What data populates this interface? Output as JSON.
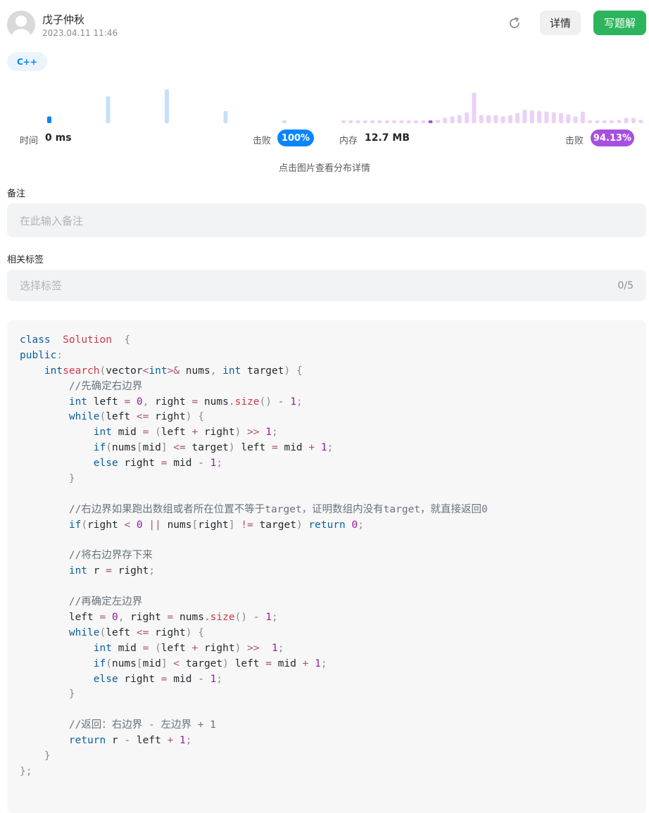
{
  "header": {
    "username": "戊子仲秋",
    "timestamp": "2023.04.11 11:46",
    "refresh_icon": "refresh-icon",
    "detail_label": "详情",
    "write_label": "写题解"
  },
  "language_tag": "C++",
  "stats": {
    "time": {
      "label": "时间",
      "value": "0 ms",
      "beat_label": "击败",
      "beat_value": "100%"
    },
    "memory": {
      "label": "内存",
      "value": "12.7 MB",
      "beat_label": "击败",
      "beat_value": "94.13%"
    },
    "hint": "点击图片查看分布详情"
  },
  "colors": {
    "time_accent": "#0a84ff",
    "time_bar": "#c4e0fb",
    "memory_accent": "#a64fe0",
    "memory_bar": "#ead1f6",
    "primary_button": "#2db55d"
  },
  "chart_data": [
    {
      "type": "bar",
      "name": "runtime-distribution",
      "values": [
        1,
        0,
        0,
        0,
        0,
        0,
        0,
        0,
        0,
        0,
        4,
        0,
        0,
        0,
        0,
        0,
        0,
        0,
        0,
        0,
        5,
        0,
        0,
        0,
        0,
        0,
        0,
        0,
        0,
        0,
        1.8,
        0,
        0,
        0,
        0,
        0,
        0,
        0,
        0,
        0,
        0.4
      ],
      "highlight_index": 0
    },
    {
      "type": "bar",
      "name": "memory-distribution",
      "values": [
        0.2,
        0.2,
        0.2,
        0.2,
        0.2,
        0.2,
        0.2,
        0.2,
        0.2,
        0.2,
        0.2,
        0.2,
        0.3,
        0.5,
        0.8,
        1.0,
        1.2,
        1.6,
        4.5,
        1.2,
        1.2,
        1.2,
        1.0,
        1.2,
        1.5,
        2.0,
        1.9,
        1.8,
        1.7,
        1.6,
        1.5,
        1.3,
        1.0,
        1.7,
        0.4,
        0.2,
        0.2,
        0.2,
        0.5,
        0.8,
        0.8,
        0.5
      ],
      "highlight_index": 12
    }
  ],
  "remark": {
    "label": "备注",
    "placeholder": "在此输入备注"
  },
  "tags": {
    "label": "相关标签",
    "placeholder": "选择标签",
    "count": "0/5"
  },
  "code_lines": [
    [
      [
        "kw",
        "class"
      ],
      [
        "",
        "  "
      ],
      [
        "cls",
        "Solution"
      ],
      [
        "",
        "  "
      ],
      [
        "pn",
        "{"
      ]
    ],
    [
      [
        "kw",
        "public"
      ],
      [
        "pn",
        ":"
      ]
    ],
    [
      [
        "",
        "    "
      ],
      [
        "ty",
        "int"
      ],
      [
        "",
        ""
      ],
      [
        "fn",
        "search"
      ],
      [
        "pn",
        "("
      ],
      [
        "",
        "vector"
      ],
      [
        "op",
        "<"
      ],
      [
        "ty",
        "int"
      ],
      [
        "op",
        ">&"
      ],
      [
        "",
        " nums"
      ],
      [
        "pn",
        ","
      ],
      [
        "",
        " "
      ],
      [
        "ty",
        "int"
      ],
      [
        "",
        " target"
      ],
      [
        "pn",
        ")"
      ],
      [
        "",
        " "
      ],
      [
        "pn",
        "{"
      ]
    ],
    [
      [
        "",
        "        "
      ],
      [
        "cm",
        "//先确定右边界"
      ]
    ],
    [
      [
        "",
        "        "
      ],
      [
        "ty",
        "int"
      ],
      [
        "",
        " left "
      ],
      [
        "op",
        "="
      ],
      [
        "",
        " "
      ],
      [
        "num",
        "0"
      ],
      [
        "pn",
        ","
      ],
      [
        "",
        " right "
      ],
      [
        "op",
        "="
      ],
      [
        "",
        " nums"
      ],
      [
        "op",
        "."
      ],
      [
        "fn",
        "size"
      ],
      [
        "pn",
        "()"
      ],
      [
        "",
        " "
      ],
      [
        "op",
        "-"
      ],
      [
        "",
        " "
      ],
      [
        "num",
        "1"
      ],
      [
        "pn",
        ";"
      ]
    ],
    [
      [
        "",
        "        "
      ],
      [
        "kw",
        "while"
      ],
      [
        "pn",
        "("
      ],
      [
        "",
        "left "
      ],
      [
        "op",
        "<="
      ],
      [
        "",
        " right"
      ],
      [
        "pn",
        ")"
      ],
      [
        "",
        " "
      ],
      [
        "pn",
        "{"
      ]
    ],
    [
      [
        "",
        "            "
      ],
      [
        "ty",
        "int"
      ],
      [
        "",
        " mid "
      ],
      [
        "op",
        "="
      ],
      [
        "",
        " "
      ],
      [
        "pn",
        "("
      ],
      [
        "",
        "left "
      ],
      [
        "op",
        "+"
      ],
      [
        "",
        " right"
      ],
      [
        "pn",
        ")"
      ],
      [
        "",
        " "
      ],
      [
        "op",
        ">>"
      ],
      [
        "",
        " "
      ],
      [
        "num",
        "1"
      ],
      [
        "pn",
        ";"
      ]
    ],
    [
      [
        "",
        "            "
      ],
      [
        "kw",
        "if"
      ],
      [
        "pn",
        "("
      ],
      [
        "",
        "nums"
      ],
      [
        "pn",
        "["
      ],
      [
        "",
        "mid"
      ],
      [
        "pn",
        "]"
      ],
      [
        "",
        " "
      ],
      [
        "op",
        "<="
      ],
      [
        "",
        " target"
      ],
      [
        "pn",
        ")"
      ],
      [
        "",
        " left "
      ],
      [
        "op",
        "="
      ],
      [
        "",
        " mid "
      ],
      [
        "op",
        "+"
      ],
      [
        "",
        " "
      ],
      [
        "num",
        "1"
      ],
      [
        "pn",
        ";"
      ]
    ],
    [
      [
        "",
        "            "
      ],
      [
        "kw",
        "else"
      ],
      [
        "",
        " right "
      ],
      [
        "op",
        "="
      ],
      [
        "",
        " mid "
      ],
      [
        "op",
        "-"
      ],
      [
        "",
        " "
      ],
      [
        "num",
        "1"
      ],
      [
        "pn",
        ";"
      ]
    ],
    [
      [
        "",
        "        "
      ],
      [
        "pn",
        "}"
      ]
    ],
    [
      [
        "",
        ""
      ]
    ],
    [
      [
        "",
        "        "
      ],
      [
        "cm",
        "//右边界如果跑出数组或者所在位置不等于target，证明数组内没有target，就直接返回0"
      ]
    ],
    [
      [
        "",
        "        "
      ],
      [
        "kw",
        "if"
      ],
      [
        "pn",
        "("
      ],
      [
        "",
        "right "
      ],
      [
        "op",
        "<"
      ],
      [
        "",
        " "
      ],
      [
        "num",
        "0"
      ],
      [
        "",
        " "
      ],
      [
        "op",
        "||"
      ],
      [
        "",
        " nums"
      ],
      [
        "pn",
        "["
      ],
      [
        "",
        "right"
      ],
      [
        "pn",
        "]"
      ],
      [
        "",
        " "
      ],
      [
        "op",
        "!="
      ],
      [
        "",
        " target"
      ],
      [
        "pn",
        ")"
      ],
      [
        "",
        " "
      ],
      [
        "kw",
        "return"
      ],
      [
        "",
        " "
      ],
      [
        "num",
        "0"
      ],
      [
        "pn",
        ";"
      ]
    ],
    [
      [
        "",
        ""
      ]
    ],
    [
      [
        "",
        "        "
      ],
      [
        "cm",
        "//将右边界存下来"
      ]
    ],
    [
      [
        "",
        "        "
      ],
      [
        "ty",
        "int"
      ],
      [
        "",
        " r "
      ],
      [
        "op",
        "="
      ],
      [
        "",
        " right"
      ],
      [
        "pn",
        ";"
      ]
    ],
    [
      [
        "",
        ""
      ]
    ],
    [
      [
        "",
        "        "
      ],
      [
        "cm",
        "//再确定左边界"
      ]
    ],
    [
      [
        "",
        "        "
      ],
      [
        "",
        "left "
      ],
      [
        "op",
        "="
      ],
      [
        "",
        " "
      ],
      [
        "num",
        "0"
      ],
      [
        "pn",
        ","
      ],
      [
        "",
        " right "
      ],
      [
        "op",
        "="
      ],
      [
        "",
        " nums"
      ],
      [
        "op",
        "."
      ],
      [
        "fn",
        "size"
      ],
      [
        "pn",
        "()"
      ],
      [
        "",
        " "
      ],
      [
        "op",
        "-"
      ],
      [
        "",
        " "
      ],
      [
        "num",
        "1"
      ],
      [
        "pn",
        ";"
      ]
    ],
    [
      [
        "",
        "        "
      ],
      [
        "kw",
        "while"
      ],
      [
        "pn",
        "("
      ],
      [
        "",
        "left "
      ],
      [
        "op",
        "<="
      ],
      [
        "",
        " right"
      ],
      [
        "pn",
        ")"
      ],
      [
        "",
        " "
      ],
      [
        "pn",
        "{"
      ]
    ],
    [
      [
        "",
        "            "
      ],
      [
        "ty",
        "int"
      ],
      [
        "",
        " mid "
      ],
      [
        "op",
        "="
      ],
      [
        "",
        " "
      ],
      [
        "pn",
        "("
      ],
      [
        "",
        "left "
      ],
      [
        "op",
        "+"
      ],
      [
        "",
        " right"
      ],
      [
        "pn",
        ")"
      ],
      [
        "",
        " "
      ],
      [
        "op",
        ">>"
      ],
      [
        "",
        "  "
      ],
      [
        "num",
        "1"
      ],
      [
        "pn",
        ";"
      ]
    ],
    [
      [
        "",
        "            "
      ],
      [
        "kw",
        "if"
      ],
      [
        "pn",
        "("
      ],
      [
        "",
        "nums"
      ],
      [
        "pn",
        "["
      ],
      [
        "",
        "mid"
      ],
      [
        "pn",
        "]"
      ],
      [
        "",
        " "
      ],
      [
        "op",
        "<"
      ],
      [
        "",
        " target"
      ],
      [
        "pn",
        ")"
      ],
      [
        "",
        " left "
      ],
      [
        "op",
        "="
      ],
      [
        "",
        " mid "
      ],
      [
        "op",
        "+"
      ],
      [
        "",
        " "
      ],
      [
        "num",
        "1"
      ],
      [
        "pn",
        ";"
      ]
    ],
    [
      [
        "",
        "            "
      ],
      [
        "kw",
        "else"
      ],
      [
        "",
        " right "
      ],
      [
        "op",
        "="
      ],
      [
        "",
        " mid "
      ],
      [
        "op",
        "-"
      ],
      [
        "",
        " "
      ],
      [
        "num",
        "1"
      ],
      [
        "pn",
        ";"
      ]
    ],
    [
      [
        "",
        "        "
      ],
      [
        "pn",
        "}"
      ]
    ],
    [
      [
        "",
        ""
      ]
    ],
    [
      [
        "",
        "        "
      ],
      [
        "cm",
        "//返回：右边界 - 左边界 + 1"
      ]
    ],
    [
      [
        "",
        "        "
      ],
      [
        "kw",
        "return"
      ],
      [
        "",
        " r "
      ],
      [
        "op",
        "-"
      ],
      [
        "",
        " left "
      ],
      [
        "op",
        "+"
      ],
      [
        "",
        " "
      ],
      [
        "num",
        "1"
      ],
      [
        "pn",
        ";"
      ]
    ],
    [
      [
        "",
        "    "
      ],
      [
        "pn",
        "}"
      ]
    ],
    [
      [
        "pn",
        "};"
      ]
    ]
  ]
}
